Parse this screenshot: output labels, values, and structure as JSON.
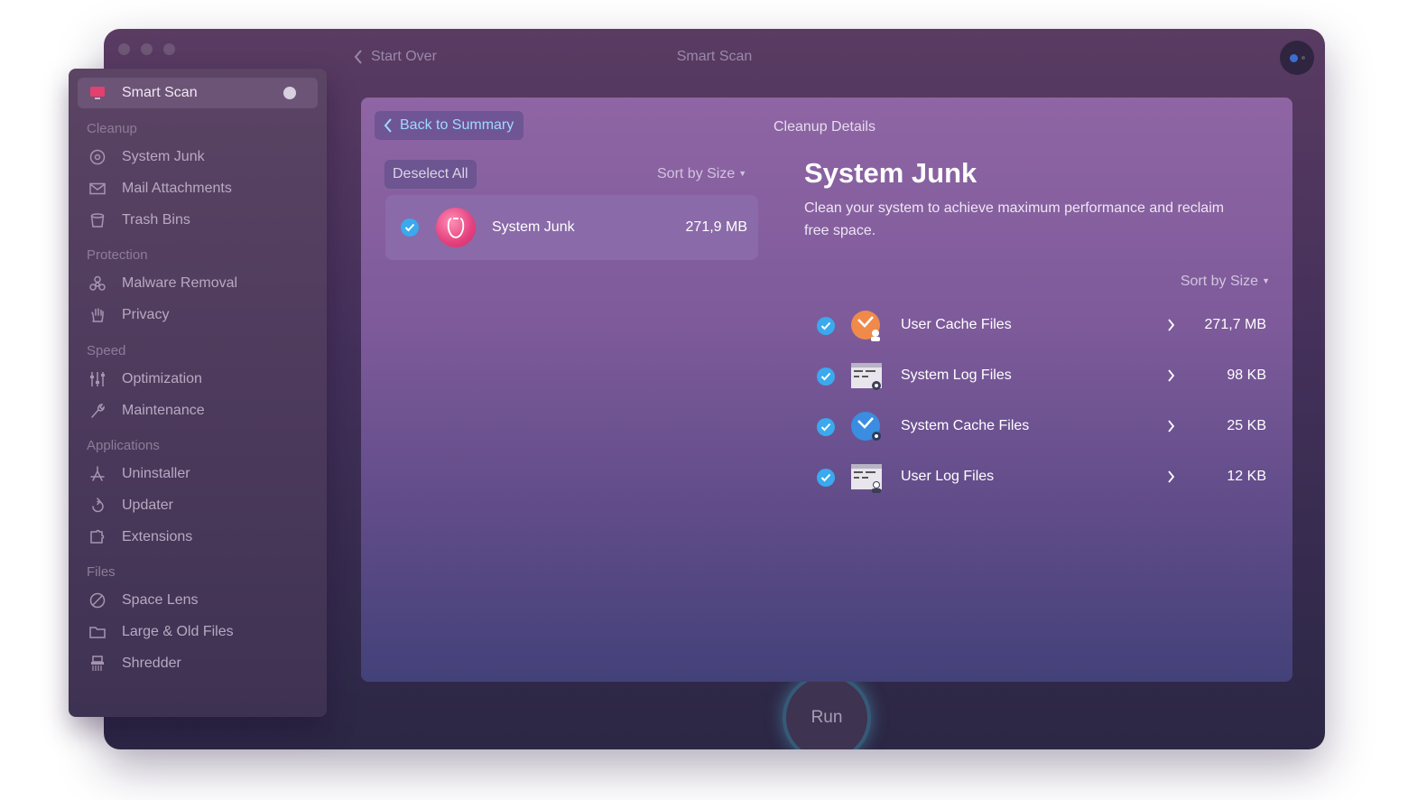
{
  "window": {
    "start_over_label": "Start Over",
    "title": "Smart Scan"
  },
  "sidebar": {
    "active": {
      "label": "Smart Scan",
      "icon": "monitor-icon"
    },
    "sections": [
      {
        "title": "Cleanup",
        "items": [
          {
            "label": "System Junk",
            "icon": "disc-icon"
          },
          {
            "label": "Mail Attachments",
            "icon": "envelope-icon"
          },
          {
            "label": "Trash Bins",
            "icon": "trash-icon"
          }
        ]
      },
      {
        "title": "Protection",
        "items": [
          {
            "label": "Malware Removal",
            "icon": "biohazard-icon"
          },
          {
            "label": "Privacy",
            "icon": "hand-icon"
          }
        ]
      },
      {
        "title": "Speed",
        "items": [
          {
            "label": "Optimization",
            "icon": "sliders-icon"
          },
          {
            "label": "Maintenance",
            "icon": "wrench-icon"
          }
        ]
      },
      {
        "title": "Applications",
        "items": [
          {
            "label": "Uninstaller",
            "icon": "uninstaller-icon"
          },
          {
            "label": "Updater",
            "icon": "update-arrow-icon"
          },
          {
            "label": "Extensions",
            "icon": "puzzle-icon"
          }
        ]
      },
      {
        "title": "Files",
        "items": [
          {
            "label": "Space Lens",
            "icon": "lens-icon"
          },
          {
            "label": "Large & Old Files",
            "icon": "folder-icon"
          },
          {
            "label": "Shredder",
            "icon": "shredder-icon"
          }
        ]
      }
    ]
  },
  "panel": {
    "back_label": "Back to Summary",
    "header": "Cleanup Details",
    "deselect_label": "Deselect All",
    "sort_label": "Sort by Size",
    "selected_item": {
      "name": "System Junk",
      "size": "271,9 MB",
      "checked": true
    },
    "detail": {
      "title": "System Junk",
      "description": "Clean your system to achieve maximum performance and reclaim free space.",
      "sort_label": "Sort by Size",
      "rows": [
        {
          "name": "User Cache Files",
          "size": "271,7 MB",
          "icon": "user-cache-icon",
          "checked": true
        },
        {
          "name": "System Log Files",
          "size": "98 KB",
          "icon": "system-log-icon",
          "checked": true
        },
        {
          "name": "System Cache Files",
          "size": "25 KB",
          "icon": "system-cache-icon",
          "checked": true
        },
        {
          "name": "User Log Files",
          "size": "12 KB",
          "icon": "user-log-icon",
          "checked": true
        }
      ]
    }
  },
  "run_label": "Run",
  "colors": {
    "accent_blue": "#3aa9ee",
    "link_blue": "#9fd9ff",
    "junk_pink": "#e4407d"
  }
}
